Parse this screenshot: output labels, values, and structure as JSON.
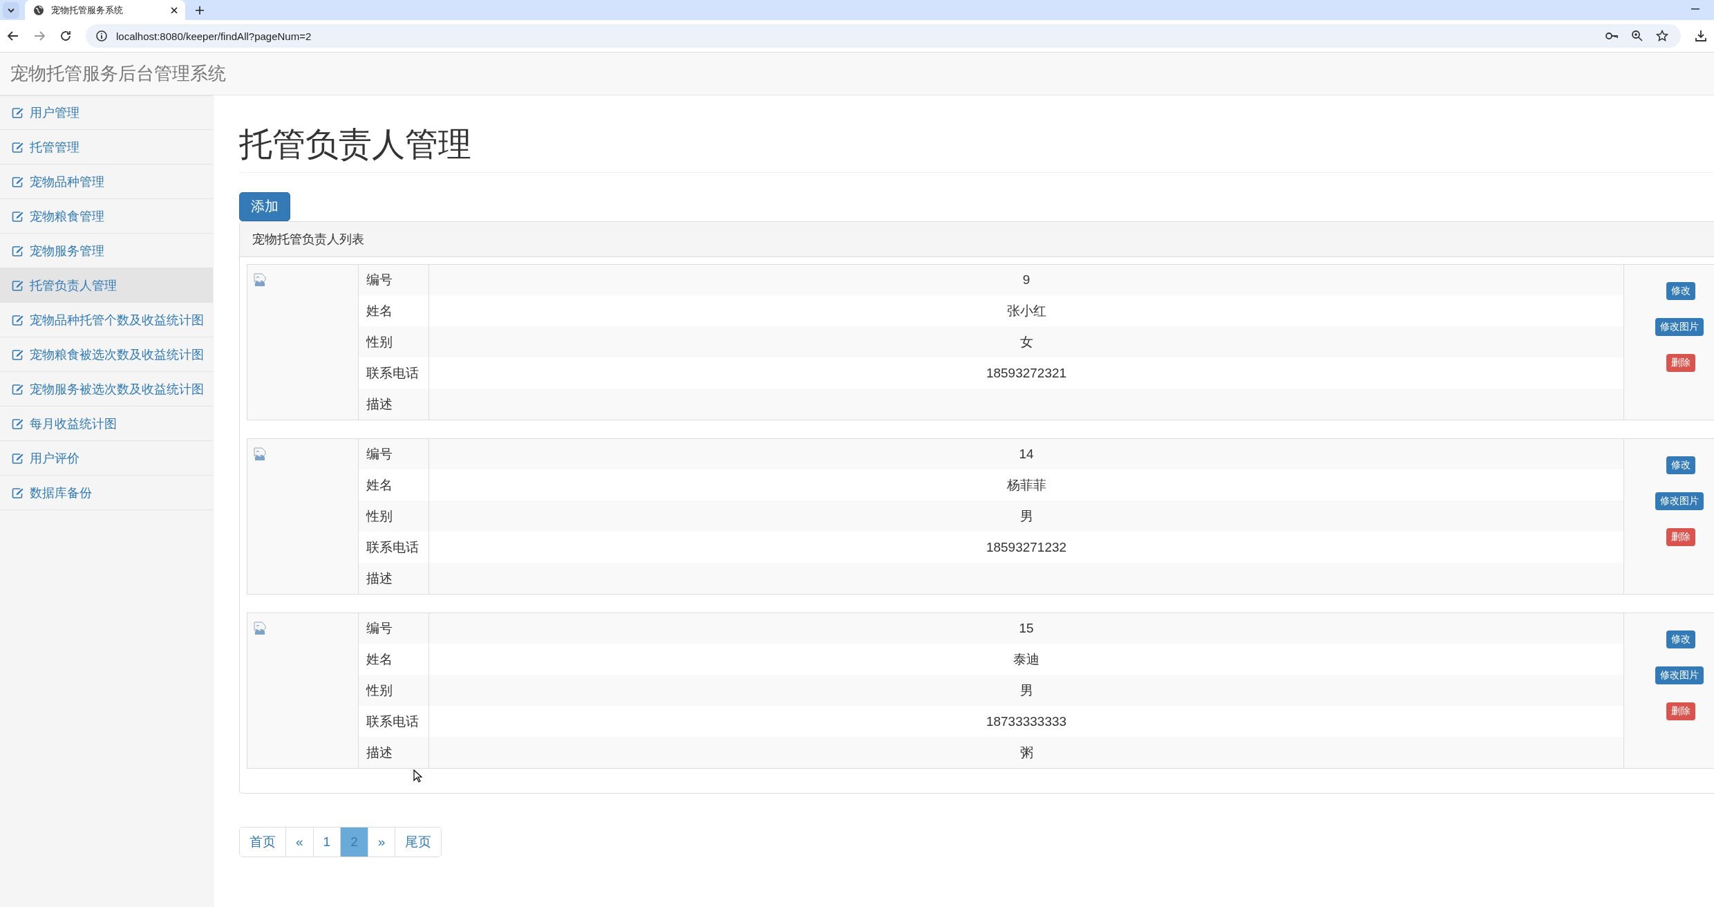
{
  "browser": {
    "tab_title": "宠物托管服务系统",
    "url": "localhost:8080/keeper/findAll?pageNum=2"
  },
  "navbar": {
    "brand": "宠物托管服务后台管理系统"
  },
  "sidebar": {
    "items": [
      {
        "label": "用户管理",
        "selected": false
      },
      {
        "label": "托管管理",
        "selected": false
      },
      {
        "label": "宠物品种管理",
        "selected": false
      },
      {
        "label": "宠物粮食管理",
        "selected": false
      },
      {
        "label": "宠物服务管理",
        "selected": false
      },
      {
        "label": "托管负责人管理",
        "selected": true
      },
      {
        "label": "宠物品种托管个数及收益统计图",
        "selected": false
      },
      {
        "label": "宠物粮食被选次数及收益统计图",
        "selected": false
      },
      {
        "label": "宠物服务被选次数及收益统计图",
        "selected": false
      },
      {
        "label": "每月收益统计图",
        "selected": false
      },
      {
        "label": "用户评价",
        "selected": false
      },
      {
        "label": "数据库备份",
        "selected": false
      }
    ]
  },
  "page": {
    "title": "托管负责人管理",
    "add_button": "添加"
  },
  "panel": {
    "title": "宠物托管负责人列表",
    "records": [
      {
        "fields": [
          {
            "label": "编号",
            "value": "9"
          },
          {
            "label": "姓名",
            "value": "张小红"
          },
          {
            "label": "性别",
            "value": "女"
          },
          {
            "label": "联系电话",
            "value": "18593272321"
          },
          {
            "label": "描述"
          }
        ],
        "actions": [
          {
            "label": "修改",
            "kind": "primary"
          },
          {
            "label": "修改图片",
            "kind": "primary"
          },
          {
            "label": "删除",
            "kind": "danger"
          }
        ]
      },
      {
        "fields": [
          {
            "label": "编号",
            "value": "14"
          },
          {
            "label": "姓名",
            "value": "杨菲菲"
          },
          {
            "label": "性别",
            "value": "男"
          },
          {
            "label": "联系电话",
            "value": "18593271232"
          },
          {
            "label": "描述"
          }
        ],
        "actions": [
          {
            "label": "修改",
            "kind": "primary"
          },
          {
            "label": "修改图片",
            "kind": "primary"
          },
          {
            "label": "删除",
            "kind": "danger"
          }
        ]
      },
      {
        "fields": [
          {
            "label": "编号",
            "value": "15"
          },
          {
            "label": "姓名",
            "value": "泰迪"
          },
          {
            "label": "性别",
            "value": "男"
          },
          {
            "label": "联系电话",
            "value": "18733333333"
          },
          {
            "label": "描述",
            "value": "粥"
          }
        ],
        "actions": [
          {
            "label": "修改",
            "kind": "primary"
          },
          {
            "label": "修改图片",
            "kind": "primary"
          },
          {
            "label": "删除",
            "kind": "danger"
          }
        ]
      }
    ]
  },
  "pagination": [
    {
      "label": "首页",
      "selected": false
    },
    {
      "label": "«",
      "selected": false
    },
    {
      "label": "1",
      "selected": false
    },
    {
      "label": "2",
      "selected": true
    },
    {
      "label": "»",
      "selected": false
    },
    {
      "label": "尾页",
      "selected": false
    }
  ]
}
